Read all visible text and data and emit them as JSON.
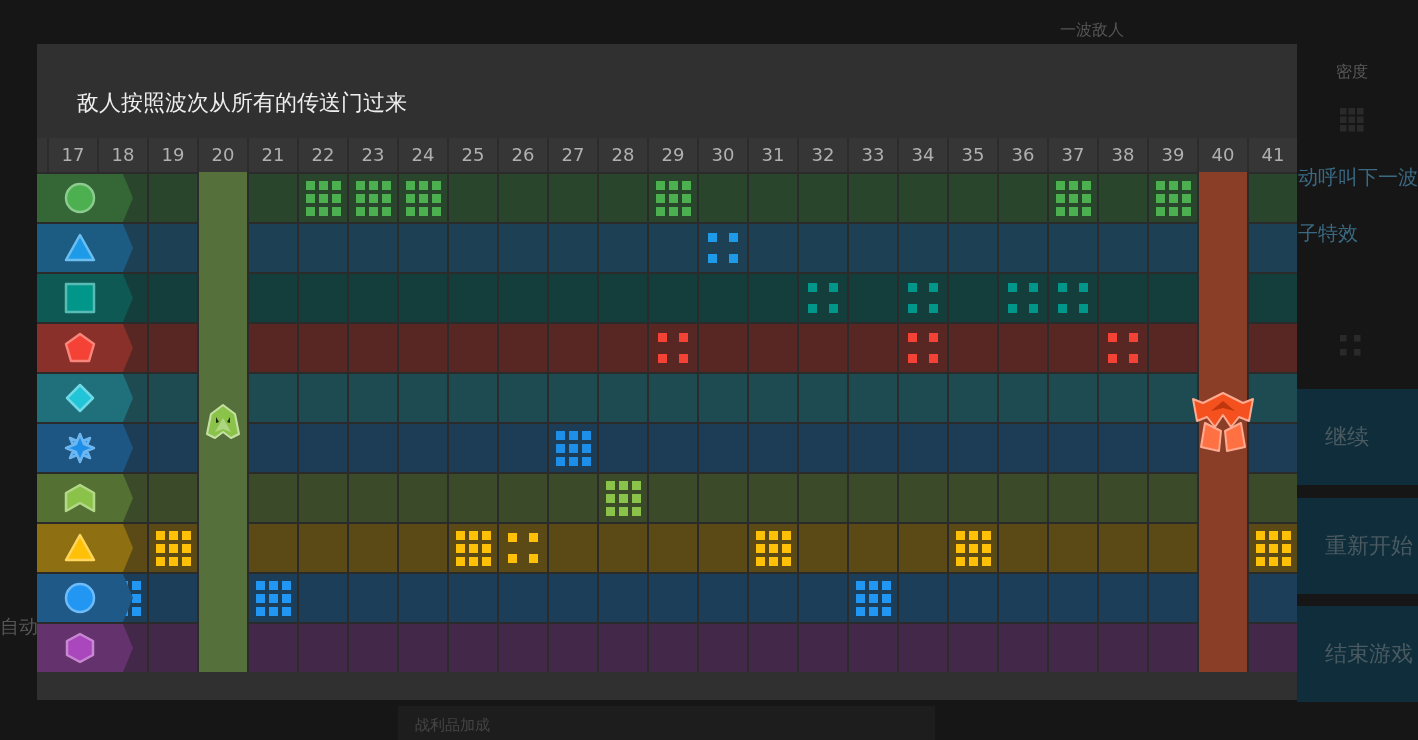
{
  "background": {
    "wave_label": "一波敌人",
    "density_label": "密度",
    "auto_call_label": "动呼叫下一波",
    "effects_label": "子特效",
    "auto_label": "自动",
    "loot_label": "战利品加成"
  },
  "menu_buttons": [
    {
      "label": "继续"
    },
    {
      "label": "重新开始"
    },
    {
      "label": "结束游戏"
    }
  ],
  "dialog": {
    "title": "敌人按照波次从所有的传送门过来",
    "columns": [
      {
        "label": "17",
        "kind": "plain"
      },
      {
        "label": "18",
        "kind": "plain"
      },
      {
        "label": "19",
        "kind": "plain"
      },
      {
        "label": "20",
        "kind": "scout",
        "color": "#55703a"
      },
      {
        "label": "21",
        "kind": "plain"
      },
      {
        "label": "22",
        "kind": "plain"
      },
      {
        "label": "23",
        "kind": "plain"
      },
      {
        "label": "24",
        "kind": "plain"
      },
      {
        "label": "25",
        "kind": "plain"
      },
      {
        "label": "26",
        "kind": "plain"
      },
      {
        "label": "27",
        "kind": "plain"
      },
      {
        "label": "28",
        "kind": "plain"
      },
      {
        "label": "29",
        "kind": "plain"
      },
      {
        "label": "30",
        "kind": "plain"
      },
      {
        "label": "31",
        "kind": "plain"
      },
      {
        "label": "32",
        "kind": "plain"
      },
      {
        "label": "33",
        "kind": "plain"
      },
      {
        "label": "34",
        "kind": "plain"
      },
      {
        "label": "35",
        "kind": "plain"
      },
      {
        "label": "36",
        "kind": "plain"
      },
      {
        "label": "37",
        "kind": "plain"
      },
      {
        "label": "38",
        "kind": "plain"
      },
      {
        "label": "39",
        "kind": "plain"
      },
      {
        "label": "40",
        "kind": "boss",
        "color": "#8a3e28"
      },
      {
        "label": "41",
        "kind": "plain"
      }
    ],
    "rows": [
      {
        "kind": "circle",
        "color": "#4caf50",
        "cells": [
          {
            "kind": "empty"
          },
          {
            "kind": "empty"
          },
          {
            "kind": "empty"
          },
          {
            "kind": "empty"
          },
          {
            "kind": "empty"
          },
          {
            "kind": "grid"
          },
          {
            "kind": "grid"
          },
          {
            "kind": "grid"
          },
          {
            "kind": "empty"
          },
          {
            "kind": "empty"
          },
          {
            "kind": "empty"
          },
          {
            "kind": "empty"
          },
          {
            "kind": "grid"
          },
          {
            "kind": "empty"
          },
          {
            "kind": "empty"
          },
          {
            "kind": "empty"
          },
          {
            "kind": "empty"
          },
          {
            "kind": "empty"
          },
          {
            "kind": "empty"
          },
          {
            "kind": "empty"
          },
          {
            "kind": "grid"
          },
          {
            "kind": "empty"
          },
          {
            "kind": "grid"
          },
          {
            "kind": "empty"
          },
          {
            "kind": "empty"
          }
        ]
      },
      {
        "kind": "triangle",
        "color": "#1e9be8",
        "cells": [
          {
            "kind": "empty"
          },
          {
            "kind": "empty"
          },
          {
            "kind": "empty"
          },
          {
            "kind": "empty"
          },
          {
            "kind": "empty"
          },
          {
            "kind": "empty"
          },
          {
            "kind": "empty"
          },
          {
            "kind": "empty"
          },
          {
            "kind": "empty"
          },
          {
            "kind": "empty"
          },
          {
            "kind": "empty"
          },
          {
            "kind": "empty"
          },
          {
            "kind": "empty"
          },
          {
            "kind": "quad"
          },
          {
            "kind": "empty"
          },
          {
            "kind": "empty"
          },
          {
            "kind": "empty"
          },
          {
            "kind": "empty"
          },
          {
            "kind": "empty"
          },
          {
            "kind": "empty"
          },
          {
            "kind": "empty"
          },
          {
            "kind": "empty"
          },
          {
            "kind": "empty"
          },
          {
            "kind": "empty"
          },
          {
            "kind": "empty"
          }
        ]
      },
      {
        "kind": "square",
        "color": "#00968a",
        "cells": [
          {
            "kind": "empty"
          },
          {
            "kind": "empty"
          },
          {
            "kind": "empty"
          },
          {
            "kind": "empty"
          },
          {
            "kind": "empty"
          },
          {
            "kind": "empty"
          },
          {
            "kind": "empty"
          },
          {
            "kind": "empty"
          },
          {
            "kind": "empty"
          },
          {
            "kind": "empty"
          },
          {
            "kind": "empty"
          },
          {
            "kind": "empty"
          },
          {
            "kind": "empty"
          },
          {
            "kind": "empty"
          },
          {
            "kind": "empty"
          },
          {
            "kind": "quad"
          },
          {
            "kind": "empty"
          },
          {
            "kind": "quad"
          },
          {
            "kind": "empty"
          },
          {
            "kind": "quad"
          },
          {
            "kind": "quad"
          },
          {
            "kind": "empty"
          },
          {
            "kind": "empty"
          },
          {
            "kind": "empty"
          },
          {
            "kind": "empty"
          }
        ]
      },
      {
        "kind": "pentagon",
        "color": "#f44336",
        "cells": [
          {
            "kind": "empty"
          },
          {
            "kind": "empty"
          },
          {
            "kind": "empty"
          },
          {
            "kind": "empty"
          },
          {
            "kind": "empty"
          },
          {
            "kind": "empty"
          },
          {
            "kind": "empty"
          },
          {
            "kind": "empty"
          },
          {
            "kind": "empty"
          },
          {
            "kind": "empty"
          },
          {
            "kind": "empty"
          },
          {
            "kind": "empty"
          },
          {
            "kind": "quad"
          },
          {
            "kind": "empty"
          },
          {
            "kind": "empty"
          },
          {
            "kind": "empty"
          },
          {
            "kind": "empty"
          },
          {
            "kind": "quad"
          },
          {
            "kind": "empty"
          },
          {
            "kind": "empty"
          },
          {
            "kind": "empty"
          },
          {
            "kind": "quad"
          },
          {
            "kind": "empty"
          },
          {
            "kind": "empty"
          },
          {
            "kind": "empty"
          }
        ]
      },
      {
        "kind": "diamond",
        "color": "#22c4d8",
        "cells": [
          {
            "kind": "empty"
          },
          {
            "kind": "empty"
          },
          {
            "kind": "empty"
          },
          {
            "kind": "empty"
          },
          {
            "kind": "empty"
          },
          {
            "kind": "empty"
          },
          {
            "kind": "empty"
          },
          {
            "kind": "empty"
          },
          {
            "kind": "empty"
          },
          {
            "kind": "empty"
          },
          {
            "kind": "empty"
          },
          {
            "kind": "empty"
          },
          {
            "kind": "empty"
          },
          {
            "kind": "empty"
          },
          {
            "kind": "empty"
          },
          {
            "kind": "empty"
          },
          {
            "kind": "empty"
          },
          {
            "kind": "empty"
          },
          {
            "kind": "empty"
          },
          {
            "kind": "empty"
          },
          {
            "kind": "empty"
          },
          {
            "kind": "empty"
          },
          {
            "kind": "empty"
          },
          {
            "kind": "empty"
          },
          {
            "kind": "empty"
          }
        ]
      },
      {
        "kind": "star",
        "color": "#1e8fe8",
        "cells": [
          {
            "kind": "empty"
          },
          {
            "kind": "empty"
          },
          {
            "kind": "empty"
          },
          {
            "kind": "empty"
          },
          {
            "kind": "empty"
          },
          {
            "kind": "empty"
          },
          {
            "kind": "empty"
          },
          {
            "kind": "empty"
          },
          {
            "kind": "empty"
          },
          {
            "kind": "empty"
          },
          {
            "kind": "grid"
          },
          {
            "kind": "empty"
          },
          {
            "kind": "empty"
          },
          {
            "kind": "empty"
          },
          {
            "kind": "empty"
          },
          {
            "kind": "empty"
          },
          {
            "kind": "empty"
          },
          {
            "kind": "empty"
          },
          {
            "kind": "empty"
          },
          {
            "kind": "empty"
          },
          {
            "kind": "empty"
          },
          {
            "kind": "empty"
          },
          {
            "kind": "empty"
          },
          {
            "kind": "empty"
          },
          {
            "kind": "empty"
          }
        ]
      },
      {
        "kind": "chevron",
        "color": "#8bc34a",
        "cells": [
          {
            "kind": "empty"
          },
          {
            "kind": "empty"
          },
          {
            "kind": "empty"
          },
          {
            "kind": "empty"
          },
          {
            "kind": "empty"
          },
          {
            "kind": "empty"
          },
          {
            "kind": "empty"
          },
          {
            "kind": "empty"
          },
          {
            "kind": "empty"
          },
          {
            "kind": "empty"
          },
          {
            "kind": "empty"
          },
          {
            "kind": "grid"
          },
          {
            "kind": "empty"
          },
          {
            "kind": "empty"
          },
          {
            "kind": "empty"
          },
          {
            "kind": "empty"
          },
          {
            "kind": "empty"
          },
          {
            "kind": "empty"
          },
          {
            "kind": "empty"
          },
          {
            "kind": "empty"
          },
          {
            "kind": "empty"
          },
          {
            "kind": "empty"
          },
          {
            "kind": "empty"
          },
          {
            "kind": "empty"
          },
          {
            "kind": "empty"
          }
        ]
      },
      {
        "kind": "triangle",
        "color": "#ffc107",
        "cells": [
          {
            "kind": "empty"
          },
          {
            "kind": "empty"
          },
          {
            "kind": "grid"
          },
          {
            "kind": "empty"
          },
          {
            "kind": "empty"
          },
          {
            "kind": "empty"
          },
          {
            "kind": "empty"
          },
          {
            "kind": "empty"
          },
          {
            "kind": "grid"
          },
          {
            "kind": "quad"
          },
          {
            "kind": "empty"
          },
          {
            "kind": "empty"
          },
          {
            "kind": "empty"
          },
          {
            "kind": "empty"
          },
          {
            "kind": "grid"
          },
          {
            "kind": "empty"
          },
          {
            "kind": "empty"
          },
          {
            "kind": "empty"
          },
          {
            "kind": "grid"
          },
          {
            "kind": "empty"
          },
          {
            "kind": "empty"
          },
          {
            "kind": "empty"
          },
          {
            "kind": "empty"
          },
          {
            "kind": "empty"
          },
          {
            "kind": "grid"
          }
        ]
      },
      {
        "kind": "circle",
        "color": "#2196f3",
        "cells": [
          {
            "kind": "empty"
          },
          {
            "kind": "grid"
          },
          {
            "kind": "empty"
          },
          {
            "kind": "empty"
          },
          {
            "kind": "grid"
          },
          {
            "kind": "empty"
          },
          {
            "kind": "empty"
          },
          {
            "kind": "empty"
          },
          {
            "kind": "empty"
          },
          {
            "kind": "empty"
          },
          {
            "kind": "empty"
          },
          {
            "kind": "empty"
          },
          {
            "kind": "empty"
          },
          {
            "kind": "empty"
          },
          {
            "kind": "empty"
          },
          {
            "kind": "empty"
          },
          {
            "kind": "grid"
          },
          {
            "kind": "empty"
          },
          {
            "kind": "empty"
          },
          {
            "kind": "empty"
          },
          {
            "kind": "empty"
          },
          {
            "kind": "empty"
          },
          {
            "kind": "empty"
          },
          {
            "kind": "empty"
          },
          {
            "kind": "empty"
          }
        ]
      },
      {
        "kind": "hexagon",
        "color": "#ab47bc",
        "cells": [
          {
            "kind": "empty"
          },
          {
            "kind": "empty"
          },
          {
            "kind": "empty"
          },
          {
            "kind": "empty"
          },
          {
            "kind": "empty"
          },
          {
            "kind": "empty"
          },
          {
            "kind": "empty"
          },
          {
            "kind": "empty"
          },
          {
            "kind": "empty"
          },
          {
            "kind": "empty"
          },
          {
            "kind": "empty"
          },
          {
            "kind": "empty"
          },
          {
            "kind": "empty"
          },
          {
            "kind": "empty"
          },
          {
            "kind": "empty"
          },
          {
            "kind": "empty"
          },
          {
            "kind": "empty"
          },
          {
            "kind": "empty"
          },
          {
            "kind": "empty"
          },
          {
            "kind": "empty"
          },
          {
            "kind": "empty"
          },
          {
            "kind": "empty"
          },
          {
            "kind": "empty"
          },
          {
            "kind": "empty"
          },
          {
            "kind": "empty"
          }
        ]
      }
    ]
  }
}
